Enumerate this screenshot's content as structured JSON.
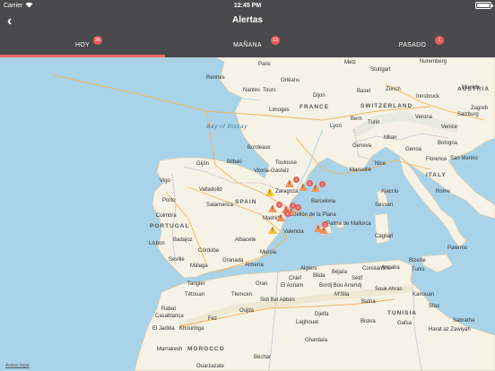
{
  "status": {
    "carrier": "Carrier",
    "time": "12:45 PM",
    "battery_percent": 100
  },
  "nav": {
    "back_icon": "chevron-left-icon",
    "title": "Alertas"
  },
  "tabs": [
    {
      "label": "HOY",
      "badge": "36",
      "active": true
    },
    {
      "label": "MAÑANA",
      "badge": "13",
      "active": false
    },
    {
      "label": "PASADO",
      "badge": "1",
      "active": false
    }
  ],
  "map": {
    "countries": [
      "FRANCE",
      "SWITZERLAND",
      "AUSTRIA",
      "ITALY",
      "SPAIN",
      "PORTUGAL",
      "MOROCCO",
      "TUNISIA"
    ],
    "seas": [
      "Bay of Biscay"
    ],
    "cities": [
      "Paris",
      "Metz",
      "Stuttgart",
      "Nuremberg",
      "Munich",
      "Rennes",
      "Nantes",
      "Orléans",
      "Dijon",
      "Basel",
      "Zürich",
      "Innsbruck",
      "Bern",
      "Tours",
      "Geneva",
      "Salzburg",
      "Milan",
      "Venice",
      "Zagreb",
      "Verona",
      "Limoges",
      "Lyon",
      "Turin",
      "Bordeaux",
      "Genoa",
      "Bologna",
      "Florence",
      "Bilbao",
      "Toulouse",
      "Nice",
      "San Marino",
      "Marseille",
      "Gijón",
      "Vitoria-Gasteiz",
      "Ajaccio",
      "Vigo",
      "Valladolid",
      "Zaragoza",
      "Rome",
      "Porto",
      "Barcelona",
      "Salamanca",
      "Coimbra",
      "Madrid",
      "Castellón de la Plana",
      "Sassari",
      "Lisbon",
      "Badajoz",
      "Palma de Mallorca",
      "Cagliari",
      "Valencia",
      "Albacete",
      "Córdoba",
      "Palermo",
      "Seville",
      "Granada",
      "Murcia",
      "Málaga",
      "Almería",
      "Algiers",
      "Bizerte",
      "Tangier",
      "Oran",
      "Tétouan",
      "Tlemcen",
      "Sétif",
      "Constantine",
      "Annaba",
      "Tunis",
      "Chlef",
      "Blida",
      "Béjaïa",
      "Rabat",
      "El Asnam",
      "Bordj Bou Arreridj",
      "Souk Ahras",
      "Casablanca",
      "Fez",
      "Sidi Bel Abbès",
      "Djelfa",
      "M'Sila",
      "Batna",
      "Sfax",
      "Oujda",
      "Kairouan",
      "El Jadida",
      "Khouribga",
      "Laghouat",
      "Biskra",
      "Gafsa",
      "Marrakesh",
      "Ouarzazate",
      "Béchar",
      "Ghardaïa",
      "Harat az Zawiyah",
      "Sabratha"
    ],
    "legal": "Avisos legal"
  },
  "alerts": [
    {
      "level": "yellow",
      "count": null
    },
    {
      "level": "orange",
      "count": "2"
    },
    {
      "level": "orange",
      "count": "2"
    },
    {
      "level": "orange",
      "count": "2"
    },
    {
      "level": "orange",
      "count": "2"
    },
    {
      "level": "red",
      "count": "3"
    },
    {
      "level": "orange",
      "count": "4"
    },
    {
      "level": "orange",
      "count": "2"
    },
    {
      "level": "yellow",
      "count": null
    },
    {
      "level": "orange",
      "count": "2"
    },
    {
      "level": "orange",
      "count": null
    }
  ],
  "colors": {
    "bar": "#4a4a4c",
    "accent": "#e85a5a",
    "sea": "#a9d3e8",
    "land": "#f6f2e6"
  }
}
